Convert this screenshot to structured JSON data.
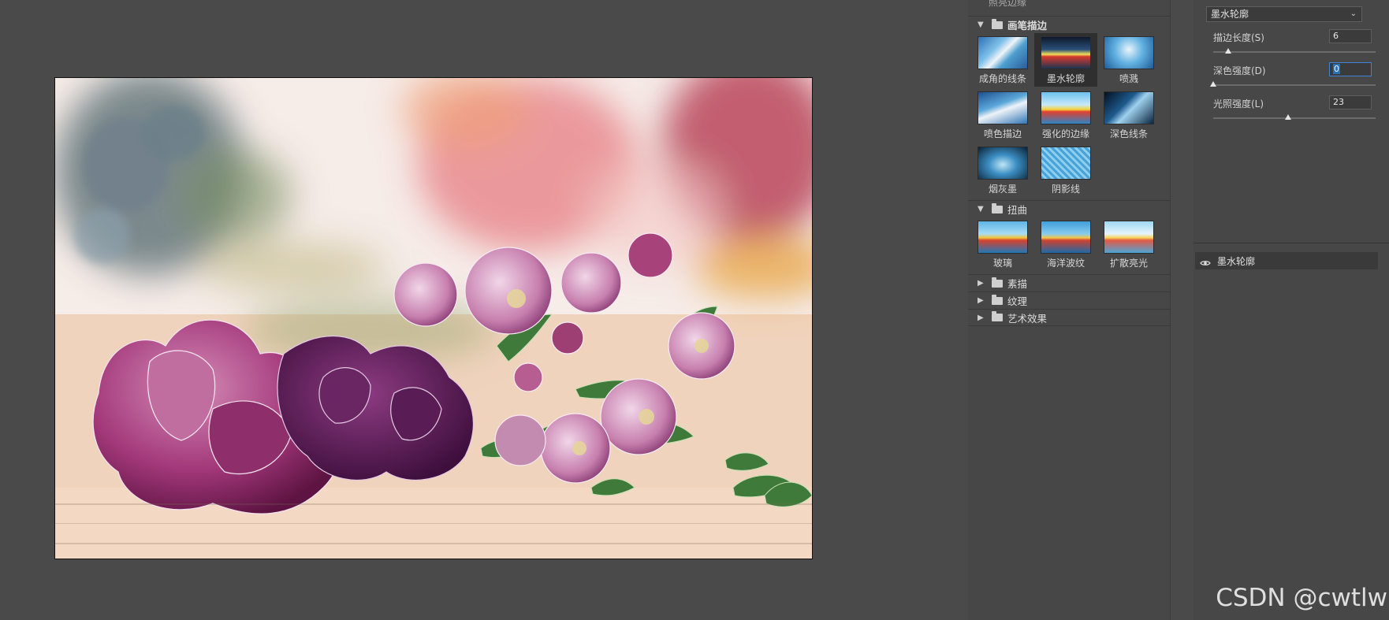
{
  "gallery": {
    "cut_row_label": "照亮边缘",
    "groups": [
      {
        "name": "画笔描边",
        "expanded": true,
        "filters": [
          "成角的线条",
          "墨水轮廓",
          "喷溅",
          "喷色描边",
          "强化的边缘",
          "深色线条",
          "烟灰墨",
          "阴影线"
        ],
        "selected": "墨水轮廓"
      },
      {
        "name": "扭曲",
        "expanded": true,
        "filters": [
          "玻璃",
          "海洋波纹",
          "扩散亮光"
        ]
      },
      {
        "name": "素描",
        "expanded": false
      },
      {
        "name": "纹理",
        "expanded": false
      },
      {
        "name": "艺术效果",
        "expanded": false
      }
    ]
  },
  "settings": {
    "selected_filter": "墨水轮廓",
    "params": [
      {
        "label": "描边长度(S)",
        "value": "6",
        "fraction": 0.09
      },
      {
        "label": "深色强度(D)",
        "value": "0",
        "fraction": 0.0,
        "active": true
      },
      {
        "label": "光照强度(L)",
        "value": "23",
        "fraction": 0.46
      }
    ]
  },
  "effect_layers": [
    {
      "name": "墨水轮廓",
      "visible": true
    }
  ],
  "watermark": "CSDN @cwtlw",
  "colors": {
    "panel_bg": "#474747",
    "canvas_bg": "#4a4a4a",
    "selection_blue": "#3a86d4"
  },
  "icons": [
    "eye-icon",
    "folder-icon",
    "triangle-expand-icon",
    "chevron-down-icon"
  ]
}
